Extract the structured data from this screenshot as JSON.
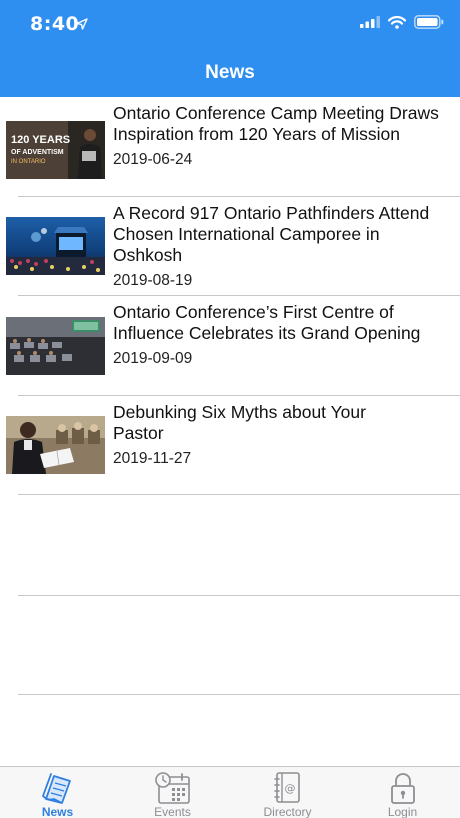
{
  "status": {
    "time": "8:40"
  },
  "header": {
    "title": "News"
  },
  "news": [
    {
      "title": "Ontario Conference Camp Meeting Draws Inspiration from 120 Years of Mission",
      "date": "2019-06-24",
      "thumb_text_1": "120 YEARS",
      "thumb_text_2": "OF ADVENTISM",
      "thumb_text_3": "IN ONTARIO"
    },
    {
      "title": "A Record 917 Ontario Pathfinders Attend Chosen International Camporee in Oshkosh",
      "date": "2019-08-19"
    },
    {
      "title": "Ontario Conference’s First Centre of Influence Celebrates its Grand Opening",
      "date": "2019-09-09"
    },
    {
      "title": "Debunking Six Myths about Your Pastor",
      "date": "2019-11-27"
    }
  ],
  "tabs": [
    {
      "label": "News",
      "icon": "news-icon",
      "active": true
    },
    {
      "label": "Events",
      "icon": "calendar-clock-icon",
      "active": false
    },
    {
      "label": "Directory",
      "icon": "address-book-icon",
      "active": false
    },
    {
      "label": "Login",
      "icon": "lock-icon",
      "active": false
    }
  ],
  "colors": {
    "accent": "#2f8ff0",
    "tab_active": "#2f7fe0",
    "tab_inactive": "#8e8e93"
  }
}
